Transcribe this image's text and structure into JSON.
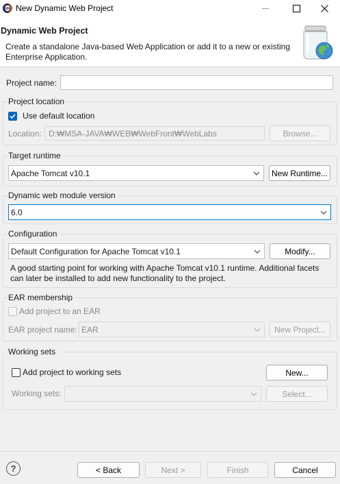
{
  "window": {
    "title": "New Dynamic Web Project",
    "minimize_icon": "minimize-icon",
    "maximize_icon": "maximize-icon",
    "close_icon": "close-icon"
  },
  "banner": {
    "title": "Dynamic Web Project",
    "description": "Create a standalone Java-based Web Application or add it to a new or existing Enterprise Application."
  },
  "project_name": {
    "label": "Project name:",
    "value": ""
  },
  "project_location": {
    "group_title": "Project location",
    "use_default_label": "Use default location",
    "use_default_checked": true,
    "location_label": "Location:",
    "location_value": "D:₩MSA-JAVA₩WEB₩WebFront₩WebLabs",
    "browse_label": "Browse..."
  },
  "target_runtime": {
    "group_title": "Target runtime",
    "selected": "Apache Tomcat v10.1",
    "new_runtime_label": "New Runtime..."
  },
  "module_version": {
    "group_title": "Dynamic web module version",
    "selected": "6.0"
  },
  "configuration": {
    "group_title": "Configuration",
    "selected": "Default Configuration for Apache Tomcat v10.1",
    "modify_label": "Modify...",
    "description": "A good starting point for working with Apache Tomcat v10.1 runtime. Additional facets can later be installed to add new functionality to the project."
  },
  "ear_membership": {
    "group_title": "EAR membership",
    "add_label": "Add project to an EAR",
    "add_checked": false,
    "ear_name_label": "EAR project name:",
    "ear_name_value": "EAR",
    "new_project_label": "New Project..."
  },
  "working_sets": {
    "group_title": "Working sets",
    "add_label": "Add project to working sets",
    "add_checked": false,
    "new_label": "New...",
    "sets_label": "Working sets:",
    "sets_value": "",
    "select_label": "Select..."
  },
  "footer": {
    "help_glyph": "?",
    "back_label": "< Back",
    "next_label": "Next >",
    "finish_label": "Finish",
    "cancel_label": "Cancel"
  },
  "colors": {
    "accent": "#0067c0",
    "focus_border": "#0078d7",
    "dialog_bg": "#f0f0f0"
  }
}
